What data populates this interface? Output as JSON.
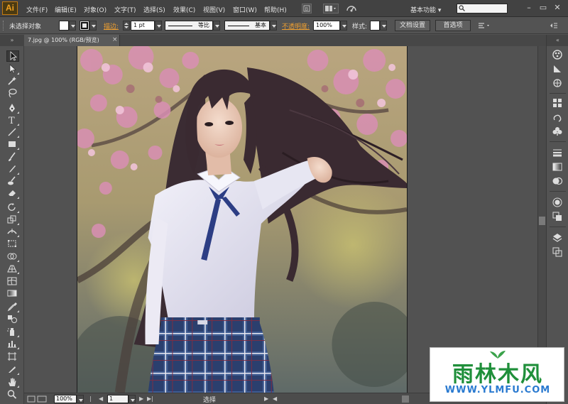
{
  "app": {
    "logo": "Ai"
  },
  "menu": [
    "文件(F)",
    "编辑(E)",
    "对象(O)",
    "文字(T)",
    "选择(S)",
    "效果(C)",
    "视图(V)",
    "窗口(W)",
    "帮助(H)"
  ],
  "workspace": {
    "label": "基本功能",
    "arrow": "▾"
  },
  "search": {
    "value": ""
  },
  "window_controls": {
    "minimize": "–",
    "maximize": "▭",
    "close": "✕"
  },
  "control": {
    "selection_status": "未选择对象",
    "stroke_label": "描边:",
    "stroke_weight": "1 pt",
    "stroke_profile": "等比",
    "brush": "基本",
    "opacity_label": "不透明度:",
    "opacity_value": "100%",
    "style_label": "样式:",
    "doc_setup": "文档设置",
    "preferences": "首选项"
  },
  "document": {
    "tab_title": "7.jpg @ 100% (RGB/预览)",
    "tab_close": "×"
  },
  "tools_panel": {
    "collapse": "»"
  },
  "dock": {
    "collapse": "«"
  },
  "status": {
    "zoom": "100%",
    "artboard": "1",
    "tool_status": "选择"
  },
  "watermark": {
    "title": "雨林木风",
    "url": "WWW.YLMFU.COM"
  },
  "colors": {
    "accent": "#f0a030",
    "panel_bg": "#535353",
    "menubar_bg": "#424242",
    "watermark_green": "#1f8f3a",
    "watermark_blue": "#2a7ad0"
  }
}
